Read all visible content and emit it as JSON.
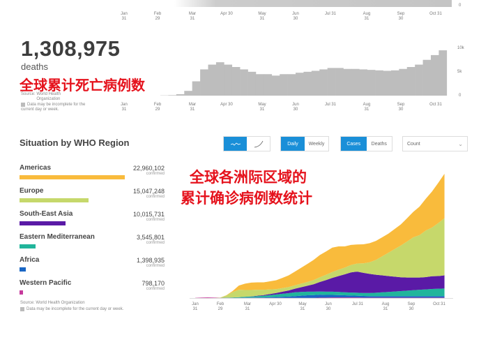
{
  "top_chart": {
    "y_tick": "0"
  },
  "x_ticks": [
    [
      "Jan",
      "31"
    ],
    [
      "Feb",
      "29"
    ],
    [
      "Mar",
      "31"
    ],
    [
      "Apr 30",
      ""
    ],
    [
      "May",
      "31"
    ],
    [
      "Jun",
      "30"
    ],
    [
      "Jul 31",
      ""
    ],
    [
      "Aug",
      "31"
    ],
    [
      "Sep",
      "30"
    ],
    [
      "Oct 31",
      ""
    ]
  ],
  "deaths": {
    "total": "1,308,975",
    "unit": "deaths",
    "annotation": "全球累计死亡病例数",
    "source_label": "Source:",
    "source": "World Health Organization",
    "note": "Data may be incomplete for the current day or week."
  },
  "region_section": {
    "title": "Situation by WHO Region",
    "toggle_chart": [
      "line-chart-icon",
      "curve-chart-icon"
    ],
    "period": {
      "options": [
        "Daily",
        "Weekly"
      ],
      "selected": "Daily"
    },
    "metric": {
      "options": [
        "Cases",
        "Deaths"
      ],
      "selected": "Cases"
    },
    "scale_select": "Count",
    "annotation_line1": "全球各洲际区域的",
    "annotation_line2": "累计确诊病例数统计",
    "source": "Source: World Health Organization",
    "note": "Data may be incomplete for the current day or week.",
    "regions": [
      {
        "name": "Americas",
        "value": "22,960,102",
        "label": "confirmed",
        "share": 1.0,
        "color": "#f9bb3c"
      },
      {
        "name": "Europe",
        "value": "15,047,248",
        "label": "confirmed",
        "share": 0.655,
        "color": "#c6d86b"
      },
      {
        "name": "South-East Asia",
        "value": "10,015,731",
        "label": "confirmed",
        "share": 0.436,
        "color": "#5a1aa6"
      },
      {
        "name": "Eastern Mediterranean",
        "value": "3,545,801",
        "label": "confirmed",
        "share": 0.154,
        "color": "#21b59b"
      },
      {
        "name": "Africa",
        "value": "1,398,935",
        "label": "confirmed",
        "share": 0.061,
        "color": "#1a66c4"
      },
      {
        "name": "Western Pacific",
        "value": "798,170",
        "label": "confirmed",
        "share": 0.035,
        "color": "#c63a9c"
      }
    ]
  },
  "chart_data": [
    {
      "type": "bar",
      "xlabel": "",
      "ylabel": "",
      "x_start": "Jan 31",
      "x_step": "week",
      "y_ticks": [
        "10k",
        "5k",
        "0"
      ],
      "ylim": [
        0,
        12000
      ],
      "color": "#bdbdbd",
      "values": [
        0,
        0,
        0,
        0,
        0,
        50,
        100,
        300,
        1000,
        3000,
        5500,
        6500,
        7000,
        6500,
        6000,
        5500,
        5000,
        4500,
        4500,
        4200,
        4500,
        4500,
        4800,
        5000,
        5200,
        5500,
        5800,
        5800,
        5600,
        5600,
        5500,
        5400,
        5300,
        5200,
        5300,
        5600,
        6000,
        6500,
        7500,
        8500,
        9500
      ]
    },
    {
      "type": "area",
      "stacked": true,
      "x_start": "Jan 31",
      "x_step": "week",
      "ylim": [
        0,
        600000
      ],
      "series": [
        {
          "name": "Western Pacific",
          "color": "#c63a9c",
          "values": [
            1000,
            2000,
            3000,
            2000,
            1000,
            1000,
            1000,
            1000,
            1000,
            1000,
            1000,
            1000,
            1000,
            1000,
            1000,
            1000,
            1000,
            1000,
            1000,
            1000,
            2000,
            2000,
            3000,
            3000,
            3000,
            3000,
            3000,
            2000,
            2000,
            2000,
            2000,
            2000,
            2000,
            2000,
            2000,
            2000,
            2000,
            2000,
            2000,
            2000,
            2000
          ]
        },
        {
          "name": "Africa",
          "color": "#1a66c4",
          "values": [
            0,
            0,
            0,
            0,
            0,
            0,
            0,
            0,
            1000,
            1000,
            2000,
            2000,
            3000,
            4000,
            5000,
            6000,
            8000,
            10000,
            12000,
            13000,
            14000,
            13000,
            12000,
            11000,
            10000,
            9000,
            8000,
            8000,
            7000,
            7000,
            7000,
            7000,
            7000,
            7000,
            7000,
            7000,
            7000,
            7000,
            7000,
            7000,
            7000
          ]
        },
        {
          "name": "Eastern Mediterranean",
          "color": "#21b59b",
          "values": [
            0,
            0,
            0,
            0,
            0,
            1000,
            2000,
            3000,
            4000,
            5000,
            6000,
            8000,
            10000,
            12000,
            14000,
            16000,
            18000,
            18000,
            17000,
            16000,
            15000,
            15000,
            15000,
            15000,
            14000,
            14000,
            14000,
            14000,
            15000,
            16000,
            18000,
            20000,
            22000,
            24000,
            26000,
            28000,
            30000,
            32000,
            34000,
            35000,
            36000
          ]
        },
        {
          "name": "South-East Asia",
          "color": "#5a1aa6",
          "values": [
            0,
            0,
            0,
            0,
            0,
            0,
            0,
            0,
            0,
            1000,
            2000,
            3000,
            5000,
            7000,
            10000,
            13000,
            17000,
            22000,
            28000,
            35000,
            45000,
            55000,
            65000,
            75000,
            85000,
            95000,
            100000,
            95000,
            90000,
            85000,
            80000,
            75000,
            70000,
            65000,
            62000,
            60000,
            58000,
            58000,
            60000,
            60000,
            62000
          ]
        },
        {
          "name": "Europe",
          "color": "#c6d86b",
          "values": [
            0,
            0,
            0,
            0,
            1000,
            10000,
            25000,
            35000,
            32000,
            30000,
            28000,
            25000,
            22000,
            18000,
            17000,
            16000,
            16000,
            17000,
            18000,
            20000,
            22000,
            25000,
            28000,
            30000,
            32000,
            35000,
            38000,
            45000,
            55000,
            70000,
            90000,
            110000,
            130000,
            150000,
            170000,
            190000,
            200000,
            220000,
            230000,
            250000,
            270000
          ]
        },
        {
          "name": "Americas",
          "color": "#f9bb3c",
          "values": [
            0,
            0,
            0,
            0,
            0,
            1000,
            5000,
            20000,
            30000,
            35000,
            35000,
            35000,
            38000,
            42000,
            48000,
            55000,
            65000,
            75000,
            85000,
            95000,
            105000,
            110000,
            115000,
            110000,
            100000,
            95000,
            90000,
            90000,
            90000,
            90000,
            90000,
            90000,
            95000,
            100000,
            110000,
            120000,
            135000,
            150000,
            170000,
            190000,
            210000
          ]
        }
      ]
    }
  ]
}
